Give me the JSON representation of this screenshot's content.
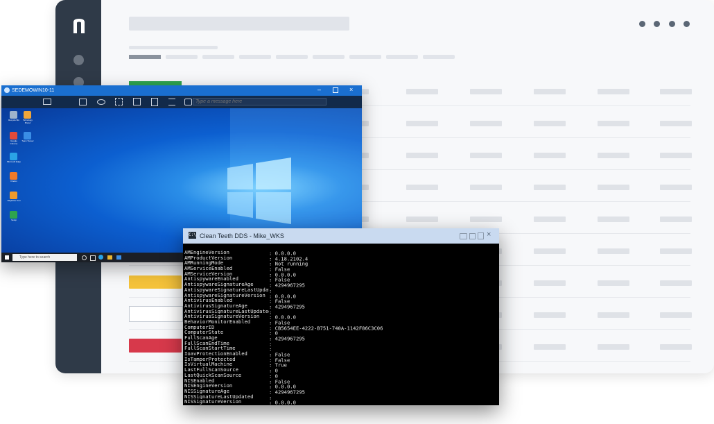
{
  "background_app": {
    "logo_letter": "n",
    "accent_colors": {
      "green": "#2ea44f",
      "yellow": "#f5c33b",
      "red": "#d7394b"
    }
  },
  "remote_desktop": {
    "title": "SEDEMOWIN10-11",
    "message_placeholder": "Type a message here",
    "search_placeholder": "Type here to search",
    "desktop_icons": [
      "Recycle Bin",
      "Tehnology Brand",
      "Google Chrome",
      "Team Viewer",
      "Microsoft Edge",
      "Firefox",
      "NinjaOne Tool",
      "Setup"
    ]
  },
  "terminal": {
    "title": "Clean Teeth DDS - Mike_WKS",
    "lines": [
      {
        "key": "AMEngineVersion",
        "value": ": 0.0.0.0"
      },
      {
        "key": "AMProductVersion",
        "value": ": 4.18.2102.4"
      },
      {
        "key": "AMRunningMode",
        "value": ": Not running"
      },
      {
        "key": "AMServiceEnabled",
        "value": ": False"
      },
      {
        "key": "AMServiceVersion",
        "value": ": 0.0.0.0"
      },
      {
        "key": "AntispywareEnabled",
        "value": ": False"
      },
      {
        "key": "AntispywareSignatureAge",
        "value": ": 4294967295"
      },
      {
        "key": "AntispywareSignatureLastUpdated",
        "value": ":"
      },
      {
        "key": "AntispywareSignatureVersion",
        "value": ": 0.0.0.0"
      },
      {
        "key": "AntivirusEnabled",
        "value": ": False"
      },
      {
        "key": "AntivirusSignatureAge",
        "value": ": 4294967295"
      },
      {
        "key": "AntivirusSignatureLastUpdated",
        "value": ":"
      },
      {
        "key": "AntivirusSignatureVersion",
        "value": ": 0.0.0.0"
      },
      {
        "key": "BehaviorMonitorEnabled",
        "value": ": False"
      },
      {
        "key": "ComputerID",
        "value": ": CB5654EE-4222-B751-740A-1142F86C3C06"
      },
      {
        "key": "ComputerState",
        "value": ": 0"
      },
      {
        "key": "FullScanAge",
        "value": ": 4294967295"
      },
      {
        "key": "FullScanEndTime",
        "value": ":"
      },
      {
        "key": "FullScanStartTime",
        "value": ":"
      },
      {
        "key": "IoavProtectionEnabled",
        "value": ": False"
      },
      {
        "key": "IsTamperProtected",
        "value": ": False"
      },
      {
        "key": "IsVirtualMachine",
        "value": ": True"
      },
      {
        "key": "LastFullScanSource",
        "value": ": 0"
      },
      {
        "key": "LastQuickScanSource",
        "value": ": 0"
      },
      {
        "key": "NISEnabled",
        "value": ": False"
      },
      {
        "key": "NISEngineVersion",
        "value": ": 0.0.0.0"
      },
      {
        "key": "NISSignatureAge",
        "value": ": 4294967295"
      },
      {
        "key": "NISSignatureLastUpdated",
        "value": ":"
      },
      {
        "key": "NISSignatureVersion",
        "value": ": 0.0.0.0"
      }
    ]
  }
}
